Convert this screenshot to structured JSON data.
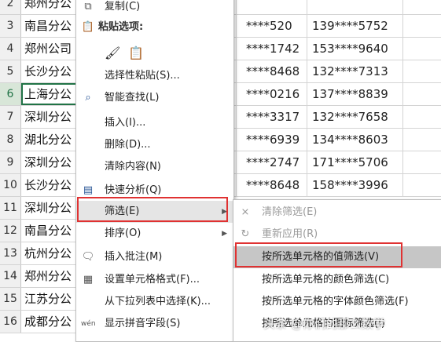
{
  "rows": [
    {
      "num": "2",
      "a": "郑州分公",
      "c": "",
      "d": ""
    },
    {
      "num": "3",
      "a": "南昌分公",
      "c": "****520",
      "d": "139****5752"
    },
    {
      "num": "4",
      "a": "郑州公司",
      "c": "****1742",
      "d": "153****9640"
    },
    {
      "num": "5",
      "a": "长沙分公",
      "c": "****8468",
      "d": "132****7313"
    },
    {
      "num": "6",
      "a": "上海分公",
      "c": "****0216",
      "d": "137****8839",
      "active": true
    },
    {
      "num": "7",
      "a": "深圳分公",
      "c": "****3317",
      "d": "132****7658"
    },
    {
      "num": "8",
      "a": "湖北分公",
      "c": "****6939",
      "d": "134****8603"
    },
    {
      "num": "9",
      "a": "深圳分公",
      "c": "****2747",
      "d": "171****5706"
    },
    {
      "num": "10",
      "a": "长沙分公",
      "c": "****8648",
      "d": "158****3996"
    },
    {
      "num": "11",
      "a": "深圳分公",
      "c": "",
      "d": ""
    },
    {
      "num": "12",
      "a": "南昌分公",
      "c": "",
      "d": ""
    },
    {
      "num": "13",
      "a": "杭州分公",
      "c": "",
      "d": ""
    },
    {
      "num": "14",
      "a": "郑州分公",
      "c": "",
      "d": ""
    },
    {
      "num": "15",
      "a": "江苏分公",
      "c": "",
      "d": ""
    },
    {
      "num": "16",
      "a": "成都分公",
      "c": "",
      "d": ""
    }
  ],
  "menu": {
    "copy": "复制(C)",
    "paste_options": "粘贴选项:",
    "paste_special": "选择性粘贴(S)...",
    "smart_lookup": "智能查找(L)",
    "insert": "插入(I)...",
    "delete": "删除(D)...",
    "clear": "清除内容(N)",
    "quick_analysis": "快速分析(Q)",
    "filter": "筛选(E)",
    "sort": "排序(O)",
    "insert_comment": "插入批注(M)",
    "format_cells": "设置单元格格式(F)...",
    "pick_list": "从下拉列表中选择(K)...",
    "phonetic": "显示拼音字段(S)"
  },
  "submenu": {
    "clear_filter": "清除筛选(E)",
    "reapply": "重新应用(R)",
    "filter_by_value": "按所选单元格的值筛选(V)",
    "filter_by_color": "按所选单元格的颜色筛选(C)",
    "filter_by_font_color": "按所选单元格的字体颜色筛选(F)",
    "filter_by_icon": "按所选单元格的图标筛选(I)"
  },
  "watermark": "头条 @你们的那么数学",
  "colors": {
    "accent": "#217346",
    "highlight_box": "#e03232",
    "menu_selected": "#e5e5e5",
    "submenu_selected": "#c6c6c6"
  }
}
